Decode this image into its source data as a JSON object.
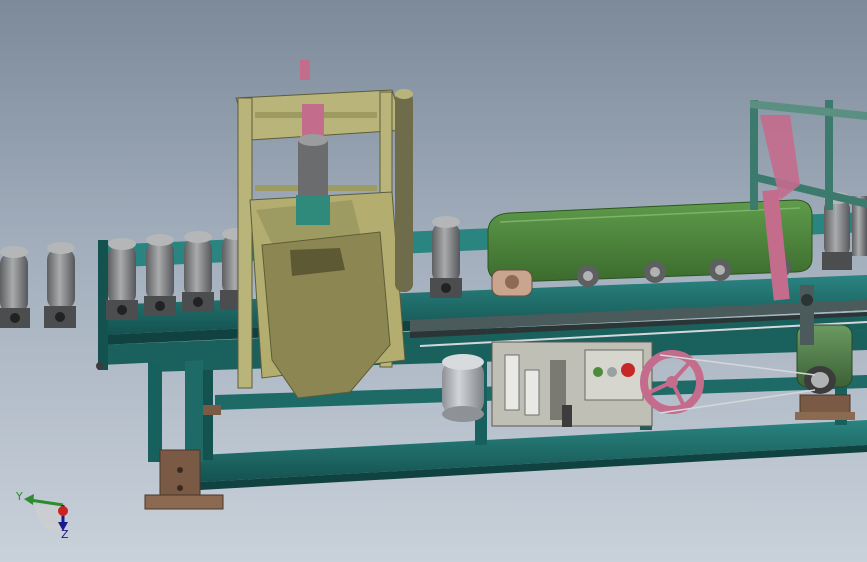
{
  "triad": {
    "y_label": "Y",
    "z_label": "Z"
  },
  "colors": {
    "background_top": "#7d8a99",
    "background_bottom": "#c9d1da",
    "frame_teal": "#1f6f6c",
    "frame_teal_dark": "#145250",
    "roller_gray": "#8a8c8e",
    "press_olive": "#b9b57a",
    "press_olive_dark": "#7d7a4c",
    "magenta": "#c46c8c",
    "belt_cover_green": "#4f8a3c",
    "panel_gray": "#bfbfb6",
    "motor_green": "#4f7a48",
    "base_brown": "#7a5a44",
    "tank_gray": "#b8bcc0"
  }
}
